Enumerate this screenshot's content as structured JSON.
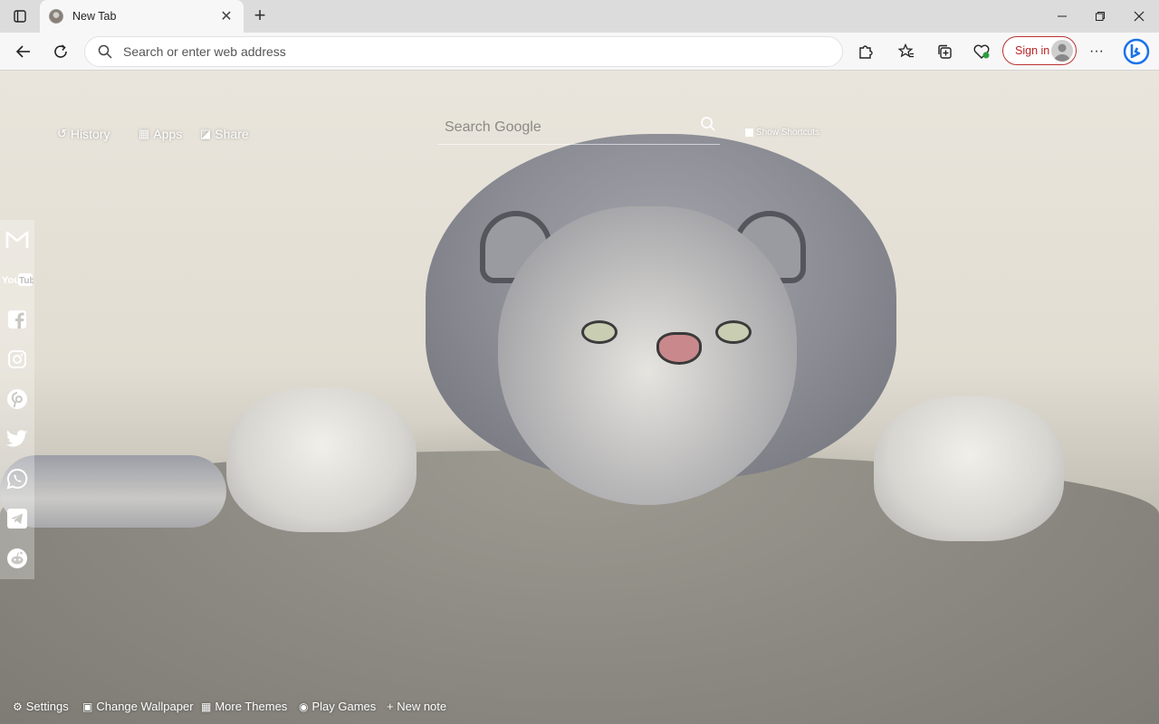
{
  "browser": {
    "tab": {
      "title": "New Tab",
      "close": "✕"
    },
    "new_tab": "+",
    "window_controls": {
      "minimize": "—",
      "restore": "❐",
      "close": "✕"
    },
    "address_bar": {
      "placeholder": "Search or enter web address",
      "value": ""
    },
    "sign_in_label": "Sign in",
    "more": "···"
  },
  "newtab": {
    "top_links": [
      {
        "label": "History",
        "icon": "history-icon",
        "glyph": "↺"
      },
      {
        "label": "Apps",
        "icon": "apps-icon",
        "glyph": "▦"
      },
      {
        "label": "Share",
        "icon": "share-icon",
        "glyph": "◪"
      }
    ],
    "search": {
      "placeholder": "Search Google"
    },
    "show_shortcuts_label": "Show Shortcuts",
    "social": [
      {
        "name": "gmail",
        "icon": "gmail-icon"
      },
      {
        "name": "youtube",
        "icon": "youtube-icon",
        "label": "You Tube"
      },
      {
        "name": "facebook",
        "icon": "facebook-icon"
      },
      {
        "name": "instagram",
        "icon": "instagram-icon"
      },
      {
        "name": "pinterest",
        "icon": "pinterest-icon"
      },
      {
        "name": "twitter",
        "icon": "twitter-icon"
      },
      {
        "name": "whatsapp",
        "icon": "whatsapp-icon"
      },
      {
        "name": "telegram",
        "icon": "telegram-icon"
      },
      {
        "name": "reddit",
        "icon": "reddit-icon"
      }
    ],
    "bottom_links": [
      {
        "label": "Settings",
        "icon": "gear-icon",
        "glyph": "⚙"
      },
      {
        "label": "Change Wallpaper",
        "icon": "wallpaper-icon",
        "glyph": "▣"
      },
      {
        "label": "More Themes",
        "icon": "themes-icon",
        "glyph": "▦"
      },
      {
        "label": "Play Games",
        "icon": "gamepad-icon",
        "glyph": "◉"
      },
      {
        "label": "+ New note",
        "icon": "",
        "glyph": ""
      }
    ]
  },
  "colors": {
    "accent_signin": "#b22222",
    "bing": "#1a73e8"
  }
}
